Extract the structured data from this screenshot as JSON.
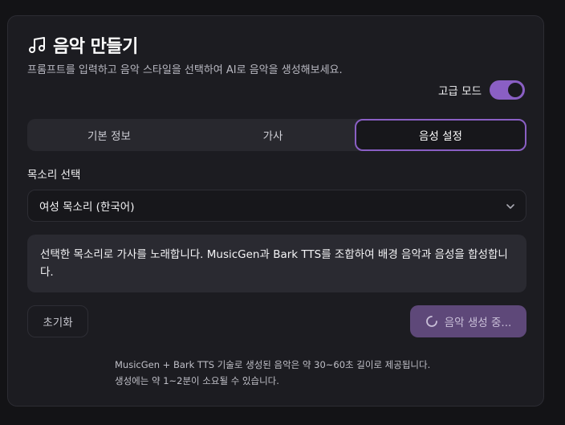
{
  "header": {
    "title": "음악 만들기",
    "subtitle": "프롬프트를 입력하고 음악 스타일을 선택하여 AI로 음악을 생성해보세요.",
    "icon": "music-note-icon"
  },
  "advanced_mode": {
    "label": "고급 모드",
    "enabled": true
  },
  "tabs": [
    {
      "label": "기본 정보",
      "active": false
    },
    {
      "label": "가사",
      "active": false
    },
    {
      "label": "음성 설정",
      "active": true
    }
  ],
  "voice": {
    "label": "목소리 선택",
    "selected": "여성 목소리 (한국어)"
  },
  "info": {
    "text": "선택한 목소리로 가사를 노래합니다. MusicGen과 Bark TTS를 조합하여 배경 음악과 음성을 합성합니다."
  },
  "actions": {
    "reset_label": "초기화",
    "generate_label": "음악 생성 중..."
  },
  "footnote": {
    "line1": "MusicGen + Bark TTS 기술로 생성된 음악은 약 30~60초 길이로 제공됩니다.",
    "line2": "생성에는 약 1~2분이 소요될 수 있습니다."
  },
  "colors": {
    "accent": "#8a5fc4",
    "generate_button": "#5e4879",
    "card_bg": "#1c1c21",
    "page_bg": "#131316"
  }
}
